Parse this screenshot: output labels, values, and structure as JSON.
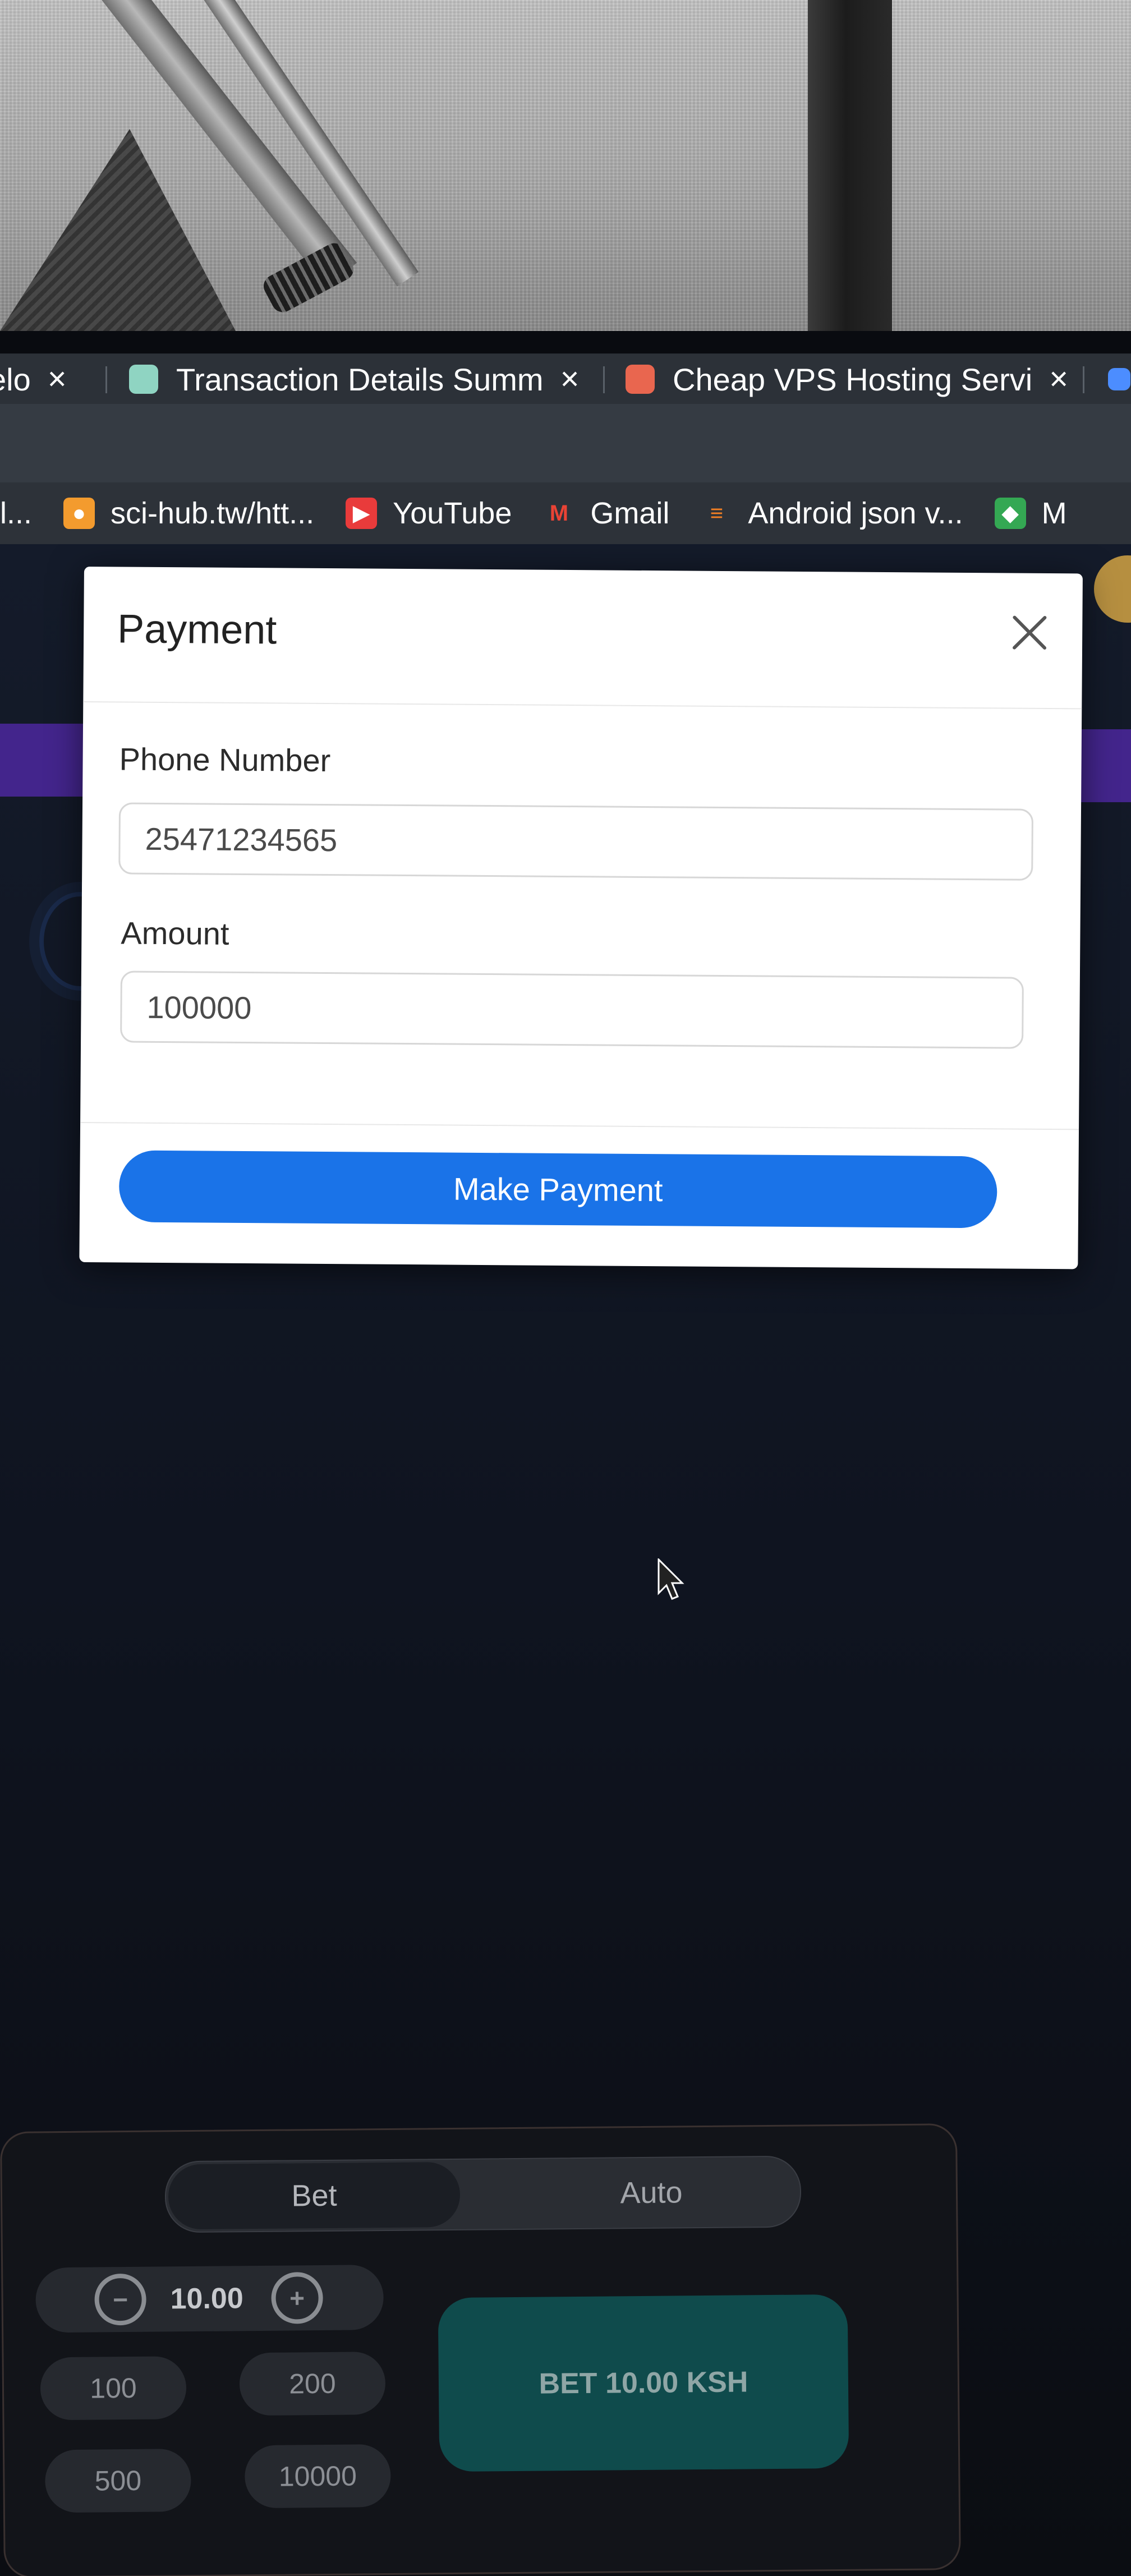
{
  "tabs": [
    {
      "label": "elo",
      "close": "×"
    },
    {
      "label": "Transaction Details Summ",
      "close": "×"
    },
    {
      "label": "Cheap VPS Hosting Servi",
      "close": "×"
    }
  ],
  "bookmarks": [
    {
      "label": "l..."
    },
    {
      "label": "sci-hub.tw/htt..."
    },
    {
      "label": "YouTube"
    },
    {
      "label": "Gmail"
    },
    {
      "label": "Android json v..."
    },
    {
      "label": "M"
    }
  ],
  "modal": {
    "title": "Payment",
    "phone_label": "Phone Number",
    "phone_value": "25471234565",
    "amount_label": "Amount",
    "amount_value": "100000",
    "button_label": "Make Payment"
  },
  "bet_panel": {
    "tab_bet": "Bet",
    "tab_auto": "Auto",
    "stake": "10.00",
    "minus": "−",
    "plus": "+",
    "chips": [
      "100",
      "200",
      "500",
      "10000"
    ],
    "bet_button": "BET 10.00 KSH"
  },
  "colors": {
    "primary_button": "#1a73e8",
    "bet_button": "#0f4b4c",
    "purple_accent": "#43258c",
    "gold_badge": "#b68f40"
  }
}
